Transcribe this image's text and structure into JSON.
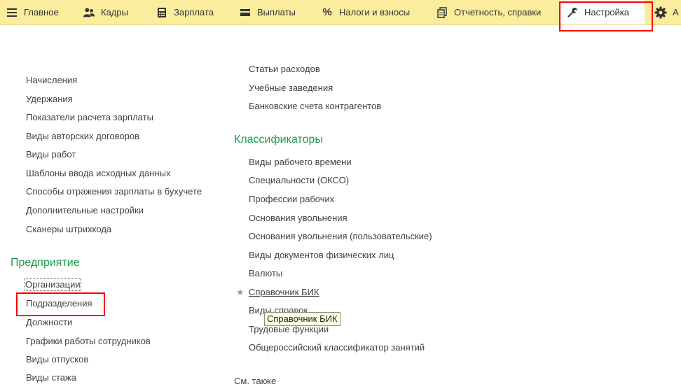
{
  "toolbar": {
    "tabs": [
      {
        "label": "Главное",
        "icon": "hamburger-icon"
      },
      {
        "label": "Кадры",
        "icon": "people-icon"
      },
      {
        "label": "Зарплата",
        "icon": "calculator-icon"
      },
      {
        "label": "Выплаты",
        "icon": "wallet-icon"
      },
      {
        "label": "Налоги и взносы",
        "icon": "percent-icon"
      },
      {
        "label": "Отчетность, справки",
        "icon": "documents-icon"
      },
      {
        "label": "Настройка",
        "icon": "wrench-icon"
      },
      {
        "label": "А",
        "icon": "gear-icon"
      }
    ],
    "active_tab": "Настройка"
  },
  "left_column": {
    "links_top": [
      "Начисления",
      "Удержания",
      "Показатели расчета зарплаты",
      "Виды авторских договоров",
      "Виды работ",
      "Шаблоны ввода исходных данных",
      "Способы отражения зарплаты в бухучете",
      "Дополнительные настройки",
      "Сканеры штрихкода"
    ],
    "enterprise_title": "Предприятие",
    "enterprise_links": [
      "Организации",
      "Подразделения",
      "Должности",
      "Графики работы сотрудников",
      "Виды отпусков",
      "Виды стажа"
    ]
  },
  "right_column": {
    "links_top": [
      "Статьи расходов",
      "Учебные заведения",
      "Банковские счета контрагентов"
    ],
    "classifiers_title": "Классификаторы",
    "classifiers_links": [
      "Виды рабочего времени",
      "Специальности (ОКСО)",
      "Профессии рабочих",
      "Основания увольнения",
      "Основания увольнения (пользовательские)",
      "Виды документов физических лиц",
      "Валюты",
      "Справочник БИК",
      "Виды справок",
      "Трудовые функции",
      "Общероссийский классификатор занятий"
    ],
    "see_also": "См. также"
  },
  "tooltip": "Справочник БИК",
  "colors": {
    "toolbar_bg": "#fbed9e",
    "section_title": "#1c9b4a",
    "highlight": "#ff0000",
    "tooltip_bg": "#ffffe1"
  }
}
